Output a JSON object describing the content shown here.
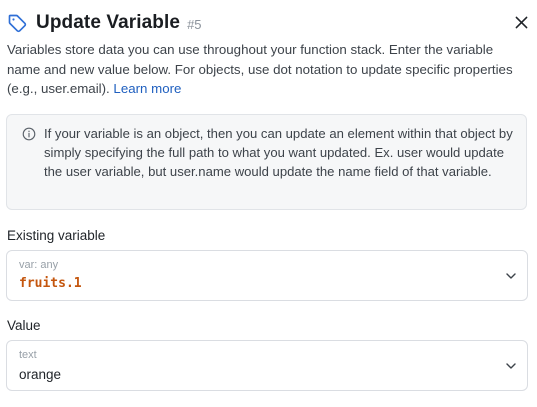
{
  "header": {
    "title": "Update Variable",
    "step": "#5",
    "tag_icon": "tag-icon",
    "close_icon": "close-icon"
  },
  "description": {
    "text": "Variables store data you can use throughout your function stack. Enter the variable name and new value below. For objects, use dot notation to update specific properties (e.g., user.email).",
    "link_label": "Learn more"
  },
  "info": {
    "icon": "info-icon",
    "text": "If your variable is an object, then you can update an element within that object by simply specifying the full path to what you want updated. Ex. user would update the user variable, but user.name would update the name field of that variable."
  },
  "existing_variable": {
    "label": "Existing variable",
    "hint": "var: any",
    "value": "fruits.1",
    "chevron_icon": "chevron-down-icon"
  },
  "value_field": {
    "label": "Value",
    "hint": "text",
    "value": "orange",
    "chevron_icon": "chevron-down-icon"
  },
  "colors": {
    "accent": "#1f5fbf",
    "variable_value": "#c4560e",
    "info_background": "#f6f7f8",
    "border": "#dadde2"
  }
}
